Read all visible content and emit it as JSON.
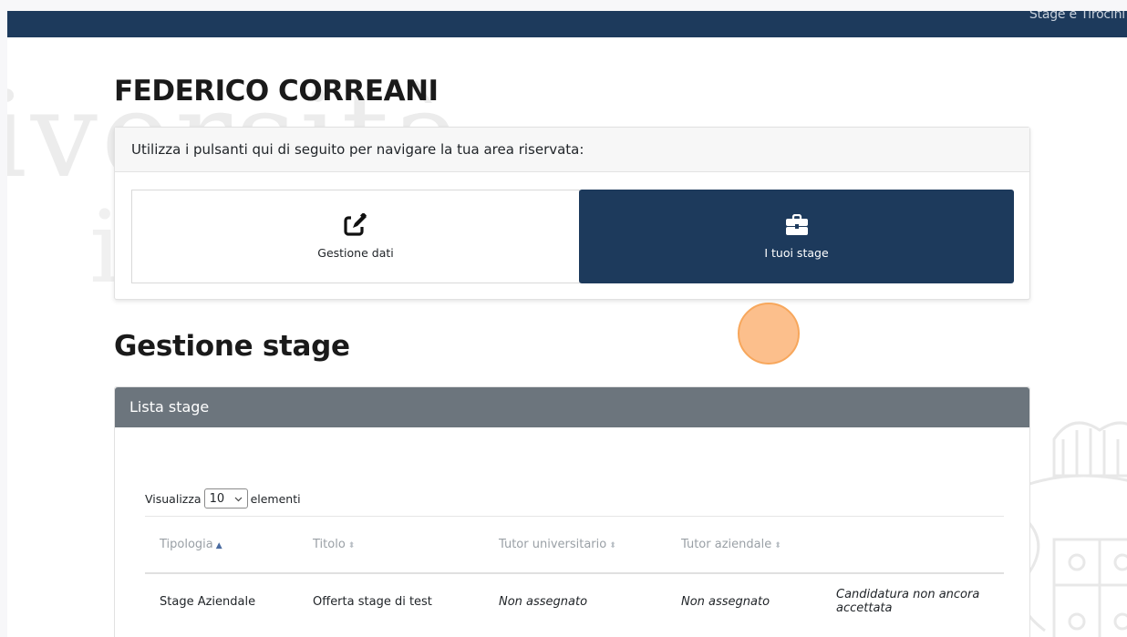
{
  "header": {
    "top_link": "Stage e Tirocini"
  },
  "watermark": {
    "line1": "iversità",
    "line2": "ic"
  },
  "profile": {
    "name": "FEDERICO CORREANI"
  },
  "nav": {
    "instructions": "Utilizza i pulsanti qui di seguito per navigare la tua area riservata:",
    "buttons": [
      {
        "label": "Gestione dati",
        "icon": "edit-icon"
      },
      {
        "label": "I tuoi stage",
        "icon": "briefcase-icon"
      }
    ]
  },
  "section": {
    "title": "Gestione stage"
  },
  "list": {
    "header": "Lista stage",
    "length_prefix": "Visualizza",
    "length_value": "10",
    "length_suffix": "elementi",
    "columns": [
      {
        "label": "Tipologia",
        "sort": "asc"
      },
      {
        "label": "Titolo",
        "sort": "both"
      },
      {
        "label": "Tutor universitario",
        "sort": "both"
      },
      {
        "label": "Tutor aziendale",
        "sort": "both"
      },
      {
        "label": "",
        "sort": "none"
      }
    ],
    "rows": [
      {
        "tipologia": "Stage Aziendale",
        "titolo": "Offerta stage di test",
        "tutor_universitario": "Non assegnato",
        "tutor_aziendale": "Non assegnato",
        "stato": "Candidatura non ancora accettata"
      }
    ]
  },
  "colors": {
    "primary": "#1d3a5c",
    "list_header": "#6c757d",
    "click_marker": "#fcb478"
  }
}
